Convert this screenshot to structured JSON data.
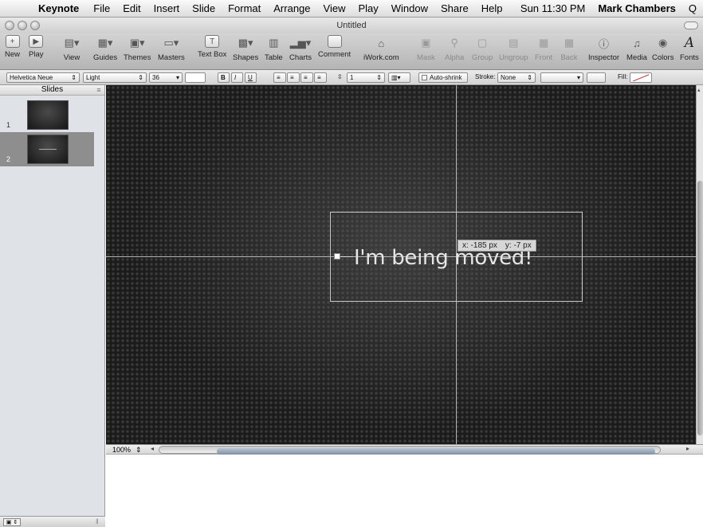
{
  "menubar": {
    "apple_glyph": "",
    "app_name": "Keynote",
    "items": [
      "File",
      "Edit",
      "Insert",
      "Slide",
      "Format",
      "Arrange",
      "View",
      "Play",
      "Window",
      "Share",
      "Help"
    ],
    "clock": "Sun 11:30 PM",
    "user": "Mark Chambers",
    "spotlight_glyph": "Q"
  },
  "window": {
    "title": "Untitled"
  },
  "toolbar": {
    "new": "New",
    "play": "Play",
    "view": "View",
    "guides": "Guides",
    "themes": "Themes",
    "masters": "Masters",
    "text_box": "Text Box",
    "shapes": "Shapes",
    "table": "Table",
    "charts": "Charts",
    "comment": "Comment",
    "iwork": "iWork.com",
    "mask": "Mask",
    "alpha": "Alpha",
    "group": "Group",
    "ungroup": "Ungroup",
    "front": "Front",
    "back": "Back",
    "inspector": "Inspector",
    "media": "Media",
    "colors": "Colors",
    "fonts": "Fonts",
    "fonts_glyph": "A"
  },
  "formatbar": {
    "font_family": "Helvetica Neue",
    "font_style": "Light",
    "font_size": "36",
    "bold": "B",
    "italic": "I",
    "underline": "U",
    "line_spacing": "1",
    "auto_shrink": "Auto-shrink",
    "stroke_label": "Stroke:",
    "stroke_value": "None",
    "fill_label": "Fill:"
  },
  "sidebar": {
    "header": "Slides",
    "slides": [
      {
        "number": "1",
        "selected": false
      },
      {
        "number": "2",
        "selected": true
      }
    ]
  },
  "canvas": {
    "slide_text": "I'm being moved!",
    "coord_x": "x: -185 px",
    "coord_y": "y: -7 px"
  },
  "zoom": {
    "value": "100%"
  },
  "colors": {
    "selection_gray": "#8e8e8e",
    "slide_background": "#1b1b1b",
    "scroll_thumb": "#7f90a6"
  }
}
